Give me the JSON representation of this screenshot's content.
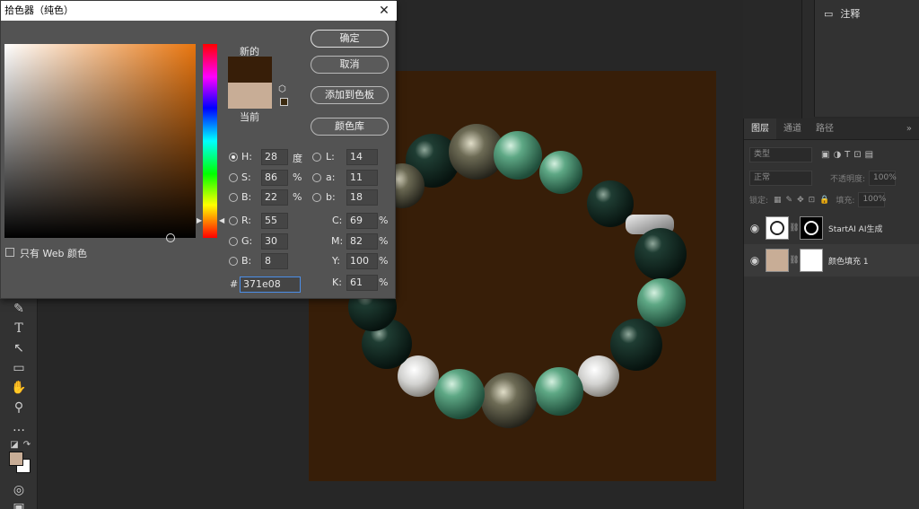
{
  "dialog": {
    "title": "拾色器（纯色）",
    "new_label": "新的",
    "current_label": "当前",
    "buttons": {
      "ok": "确定",
      "cancel": "取消",
      "add_to_swatches": "添加到色板",
      "color_libraries": "颜色库"
    },
    "web_only_label": "只有 Web 颜色",
    "new_color": "#371e08",
    "current_color": "#c8ad96",
    "fields": {
      "H": {
        "label": "H:",
        "value": "28",
        "unit": "度"
      },
      "S": {
        "label": "S:",
        "value": "86",
        "unit": "%"
      },
      "B": {
        "label": "B:",
        "value": "22",
        "unit": "%"
      },
      "R": {
        "label": "R:",
        "value": "55"
      },
      "G": {
        "label": "G:",
        "value": "30"
      },
      "Bl": {
        "label": "B:",
        "value": "8"
      },
      "L": {
        "label": "L:",
        "value": "14"
      },
      "a": {
        "label": "a:",
        "value": "11"
      },
      "b": {
        "label": "b:",
        "value": "18"
      },
      "C": {
        "label": "C:",
        "value": "69",
        "unit": "%"
      },
      "M": {
        "label": "M:",
        "value": "82",
        "unit": "%"
      },
      "Y": {
        "label": "Y:",
        "value": "100",
        "unit": "%"
      },
      "K": {
        "label": "K:",
        "value": "61",
        "unit": "%"
      }
    },
    "hex_label": "#",
    "hex_value": "371e08"
  },
  "notes_panel": {
    "title": "注释"
  },
  "layers_panel": {
    "tabs": [
      "图层",
      "通道",
      "路径"
    ],
    "filter_placeholder": "类型",
    "blend_mode": "正常",
    "opacity_label": "不透明度:",
    "opacity_value": "100%",
    "lock_label": "锁定:",
    "fill_label": "填充:",
    "fill_value": "100%",
    "layers": [
      {
        "name": "StartAI AI生成"
      },
      {
        "name": "颜色填充 1"
      }
    ]
  },
  "icons": {
    "close": "close-icon",
    "notes": "comment-icon",
    "eye": "eye-icon",
    "link": "link-icon"
  },
  "colors": {
    "document_bg": "#371e08",
    "foreground": "#c8ad96",
    "background": "#ffffff"
  }
}
